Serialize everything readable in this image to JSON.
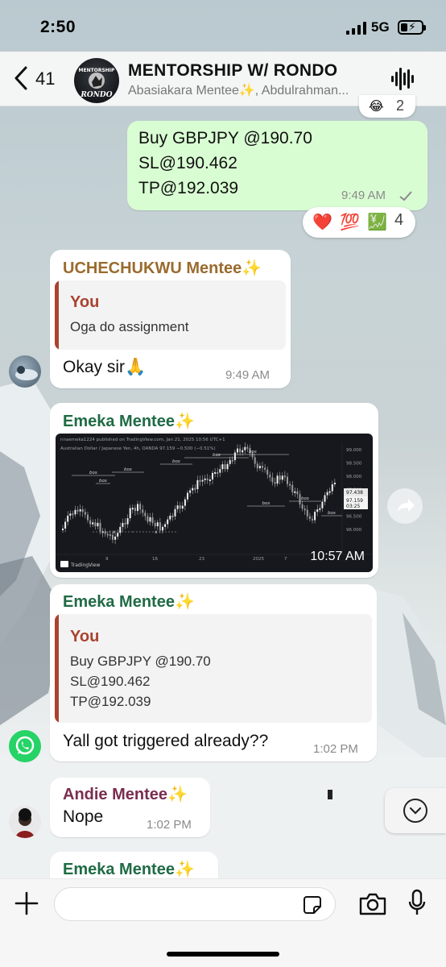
{
  "status_bar": {
    "time": "2:50",
    "network": "5G"
  },
  "header": {
    "back_count": "41",
    "group_name": "MENTORSHIP W/ RONDO",
    "group_members": "Abasiakara Mentee✨, Abdulrahman..."
  },
  "avatar_text": {
    "line1": "MENTORSHIP",
    "line2": "RONDO"
  },
  "top_reaction_count": "2",
  "messages": [
    {
      "direction": "outgoing",
      "lines": [
        "Buy GBPJPY @190.70",
        "SL@190.462",
        "TP@192.039"
      ],
      "time": "9:49 AM",
      "reactions": [
        "❤️",
        "💯",
        "💹"
      ],
      "reaction_count": "4"
    },
    {
      "sender": "UCHECHUKWU Mentee✨",
      "sender_color": "#9a6b2e",
      "quote": {
        "name": "You",
        "text": "Oga do assignment"
      },
      "text": "Okay sir🙏",
      "time": "9:49 AM"
    },
    {
      "sender": "Emeka Mentee✨",
      "sender_color": "#1f6b44",
      "image_time": "10:57 AM"
    },
    {
      "sender": "Emeka Mentee✨",
      "sender_color": "#1f6b44",
      "quote": {
        "name": "You",
        "lines": [
          "Buy GBPJPY @190.70",
          "SL@190.462",
          "TP@192.039"
        ]
      },
      "text": "Yall got triggered already??",
      "time": "1:02 PM"
    },
    {
      "sender": "Andie Mentee✨",
      "sender_color": "#7a2e4e",
      "text": "Nope",
      "time": "1:02 PM"
    },
    {
      "sender": "Emeka Mentee✨",
      "sender_color": "#1f6b44"
    }
  ],
  "chart_image": {
    "header": "nnaemeka1224 published on TradingView.com, Jan 21, 2025 10:56 UTC+1",
    "symbol": "Australian Dollar / Japanese Yen, 4h, OANDA  97.159  −0.500 (−0.51%)",
    "price_ticks": [
      "99.000",
      "98.500",
      "98.000",
      "97.500",
      "97.000",
      "96.500",
      "96.000"
    ],
    "date_ticks": [
      "9",
      "16",
      "23",
      "2025",
      "7"
    ],
    "last_price": "97.438",
    "current_price": "97.159",
    "countdown": "03:25",
    "annotation_label": "bos",
    "x_marker": "x",
    "brand": "TradingView"
  }
}
